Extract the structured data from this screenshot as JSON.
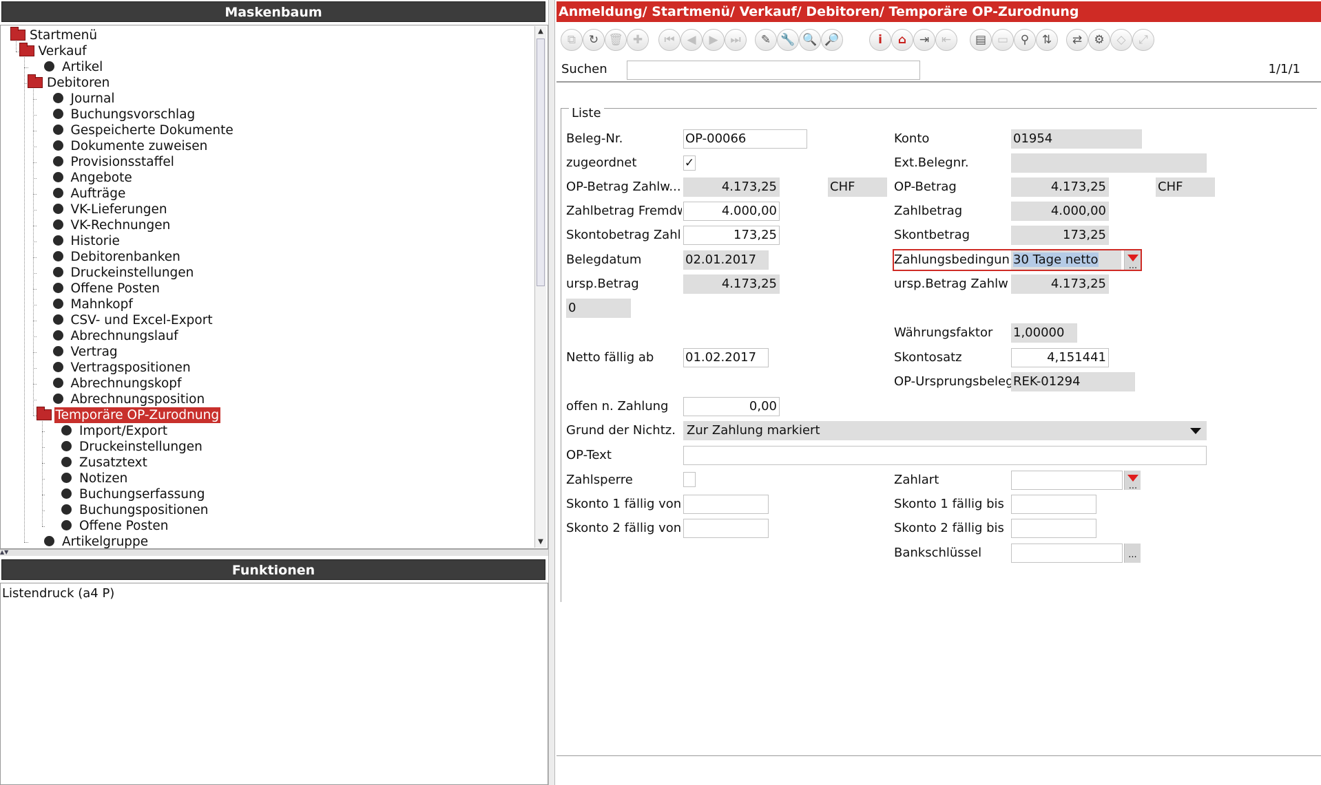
{
  "left": {
    "tree_title": "Maskenbaum",
    "tree": [
      {
        "label": "Startmenü",
        "kind": "folder",
        "level": 0
      },
      {
        "label": "Verkauf",
        "kind": "folder",
        "level": 1
      },
      {
        "label": "Artikel",
        "kind": "leaf",
        "level": 2
      },
      {
        "label": "Debitoren",
        "kind": "folder",
        "level": 2
      },
      {
        "label": "Journal",
        "kind": "leaf",
        "level": 3
      },
      {
        "label": "Buchungsvorschlag",
        "kind": "leaf",
        "level": 3
      },
      {
        "label": "Gespeicherte Dokumente",
        "kind": "leaf",
        "level": 3
      },
      {
        "label": "Dokumente zuweisen",
        "kind": "leaf",
        "level": 3
      },
      {
        "label": "Provisionsstaffel",
        "kind": "leaf",
        "level": 3
      },
      {
        "label": "Angebote",
        "kind": "leaf",
        "level": 3
      },
      {
        "label": "Aufträge",
        "kind": "leaf",
        "level": 3
      },
      {
        "label": "VK-Lieferungen",
        "kind": "leaf",
        "level": 3
      },
      {
        "label": "VK-Rechnungen",
        "kind": "leaf",
        "level": 3
      },
      {
        "label": "Historie",
        "kind": "leaf",
        "level": 3
      },
      {
        "label": "Debitorenbanken",
        "kind": "leaf",
        "level": 3
      },
      {
        "label": "Druckeinstellungen",
        "kind": "leaf",
        "level": 3
      },
      {
        "label": "Offene Posten",
        "kind": "leaf",
        "level": 3
      },
      {
        "label": "Mahnkopf",
        "kind": "leaf",
        "level": 3
      },
      {
        "label": "CSV- und Excel-Export",
        "kind": "leaf",
        "level": 3
      },
      {
        "label": "Abrechnungslauf",
        "kind": "leaf",
        "level": 3
      },
      {
        "label": "Vertrag",
        "kind": "leaf",
        "level": 3
      },
      {
        "label": "Vertragspositionen",
        "kind": "leaf",
        "level": 3
      },
      {
        "label": "Abrechnungskopf",
        "kind": "leaf",
        "level": 3
      },
      {
        "label": "Abrechnungsposition",
        "kind": "leaf",
        "level": 3
      },
      {
        "label": "Temporäre OP-Zurodnung",
        "kind": "folder",
        "level": 3,
        "selected": true
      },
      {
        "label": "Import/Export",
        "kind": "leaf",
        "level": 4
      },
      {
        "label": "Druckeinstellungen",
        "kind": "leaf",
        "level": 4
      },
      {
        "label": "Zusatztext",
        "kind": "leaf",
        "level": 4
      },
      {
        "label": "Notizen",
        "kind": "leaf",
        "level": 4
      },
      {
        "label": "Buchungserfassung",
        "kind": "leaf",
        "level": 4
      },
      {
        "label": "Buchungspositionen",
        "kind": "leaf",
        "level": 4
      },
      {
        "label": "Offene Posten",
        "kind": "leaf",
        "level": 4
      },
      {
        "label": "Artikelgruppe",
        "kind": "leaf",
        "level": 2
      }
    ],
    "functions_title": "Funktionen",
    "functions": [
      "Listendruck (a4 P)"
    ]
  },
  "right": {
    "breadcrumb": "Anmeldung/ Startmenü/ Verkauf/ Debitoren/ Temporäre OP-Zurodnung",
    "search_label": "Suchen",
    "search_value": "",
    "page_info": "1/1/1",
    "fieldset_legend": "Liste",
    "toolbar": [
      {
        "icon": "copy-icon",
        "glyph": "⧉",
        "enabled": false
      },
      {
        "icon": "refresh-icon",
        "glyph": "↻",
        "enabled": true
      },
      {
        "icon": "trash-icon",
        "glyph": "🗑",
        "enabled": false
      },
      {
        "icon": "add-icon",
        "glyph": "✚",
        "enabled": false
      },
      {
        "icon": "first-record-icon",
        "glyph": "⏮",
        "enabled": false
      },
      {
        "icon": "previous-record-icon",
        "glyph": "◀",
        "enabled": false
      },
      {
        "icon": "next-record-icon",
        "glyph": "▶",
        "enabled": false
      },
      {
        "icon": "last-record-icon",
        "glyph": "⏭",
        "enabled": false
      },
      {
        "icon": "edit-icon",
        "glyph": "✎",
        "enabled": true
      },
      {
        "icon": "tools-icon",
        "glyph": "🔧",
        "enabled": true
      },
      {
        "icon": "find-replace-icon",
        "glyph": "🔍",
        "enabled": false
      },
      {
        "icon": "find-next-icon",
        "glyph": "🔎",
        "enabled": false
      },
      {
        "icon": "info-icon",
        "glyph": "i",
        "enabled": true
      },
      {
        "icon": "home-icon",
        "glyph": "⌂",
        "enabled": true
      },
      {
        "icon": "import-icon",
        "glyph": "⇥",
        "enabled": true
      },
      {
        "icon": "export-icon",
        "glyph": "⇤",
        "enabled": false
      },
      {
        "icon": "document-icon",
        "glyph": "▤",
        "enabled": true
      },
      {
        "icon": "window-icon",
        "glyph": "▭",
        "enabled": false
      },
      {
        "icon": "search-icon",
        "glyph": "⚲",
        "enabled": true
      },
      {
        "icon": "sort-icon",
        "glyph": "⇅",
        "enabled": true
      },
      {
        "icon": "switch-icon",
        "glyph": "⇄",
        "enabled": true
      },
      {
        "icon": "settings-icon",
        "glyph": "⚙",
        "enabled": true
      },
      {
        "icon": "tag-icon",
        "glyph": "◇",
        "enabled": false
      },
      {
        "icon": "expand-icon",
        "glyph": "⤢",
        "enabled": false
      }
    ],
    "form": {
      "beleg_nr": {
        "label": "Beleg-Nr.",
        "value": "OP-00066"
      },
      "konto": {
        "label": "Konto",
        "value": "01954"
      },
      "zugeordnet": {
        "label": "zugeordnet",
        "checked": true,
        "mark": "✓"
      },
      "ext_belegnr": {
        "label": "Ext.Belegnr.",
        "value": ""
      },
      "op_betrag_zahlw": {
        "label": "OP-Betrag Zahlw...",
        "value": "4.173,25",
        "currency": "CHF"
      },
      "op_betrag": {
        "label": "OP-Betrag",
        "value": "4.173,25",
        "currency": "CHF"
      },
      "zahlbetrag_fremdw": {
        "label": "Zahlbetrag Fremdw",
        "value": "4.000,00"
      },
      "zahlbetrag": {
        "label": "Zahlbetrag",
        "value": "4.000,00"
      },
      "skontobetrag_zahl": {
        "label": "Skontobetrag Zahl",
        "value": "173,25"
      },
      "skontbetrag": {
        "label": "Skontbetrag",
        "value": "173,25"
      },
      "belegdatum": {
        "label": "Belegdatum",
        "value": "02.01.2017"
      },
      "zahlungsbedingung": {
        "label": "Zahlungsbedingun",
        "value": "30 Tage netto"
      },
      "ursp_betrag": {
        "label": "ursp.Betrag",
        "value": "4.173,25"
      },
      "ursp_betrag_zahlw": {
        "label": "ursp.Betrag Zahlw",
        "value": "4.173,25"
      },
      "unnamed_zero": {
        "value": "0"
      },
      "waehrungsfaktor": {
        "label": "Währungsfaktor",
        "value": "1,00000"
      },
      "netto_faellig_ab": {
        "label": "Netto fällig ab",
        "value": "01.02.2017"
      },
      "skontosatz": {
        "label": "Skontosatz",
        "value": "4,151441"
      },
      "op_ursprungsbeleg": {
        "label": "OP-Ursprungsbeleg",
        "value": "REK-01294"
      },
      "offen_n_zahlung": {
        "label": "offen n. Zahlung",
        "value": "0,00"
      },
      "grund_der_nichtz": {
        "label": "Grund der Nichtz.",
        "value": "Zur Zahlung markiert"
      },
      "op_text": {
        "label": "OP-Text",
        "value": ""
      },
      "zahlsperre": {
        "label": "Zahlsperre",
        "checked": false
      },
      "zahlart": {
        "label": "Zahlart",
        "value": ""
      },
      "skonto1_von": {
        "label": "Skonto 1 fällig von",
        "value": ""
      },
      "skonto1_bis": {
        "label": "Skonto 1 fällig bis",
        "value": ""
      },
      "skonto2_von": {
        "label": "Skonto 2 fällig von",
        "value": ""
      },
      "skonto2_bis": {
        "label": "Skonto 2 fällig bis",
        "value": ""
      },
      "bankschluessel": {
        "label": "Bankschlüssel",
        "value": ""
      },
      "ellipsis": "..."
    }
  },
  "colors": {
    "accent": "#cf2b25",
    "header_dark": "#3c3c3c",
    "readonly_bg": "#dedede",
    "selection_blue": "#b5cbe6"
  }
}
